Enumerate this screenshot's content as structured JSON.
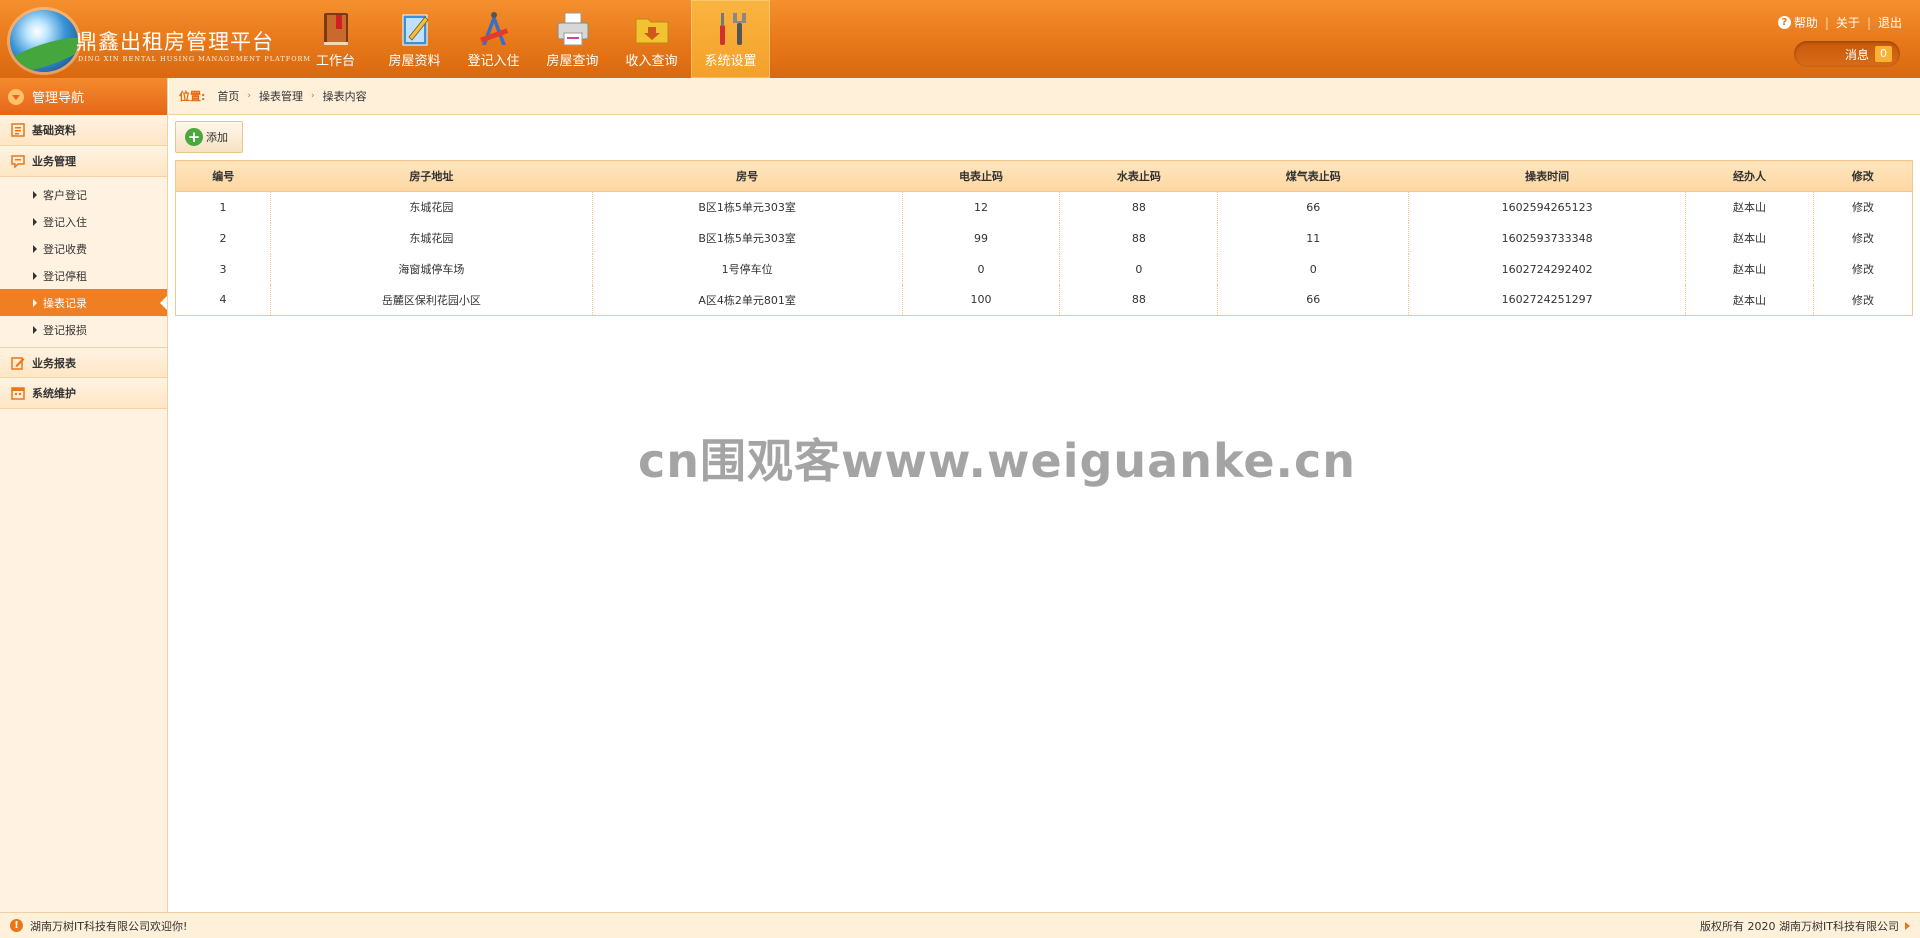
{
  "app": {
    "title": "鼎鑫出租房管理平台",
    "subtitle": "DING XIN RENTAL HUSING MANAGEMENT PLATFORM"
  },
  "topnav": [
    {
      "label": "工作台",
      "icon": "book-icon"
    },
    {
      "label": "房屋资料",
      "icon": "notepad-icon"
    },
    {
      "label": "登记入住",
      "icon": "drafting-tools-icon"
    },
    {
      "label": "房屋查询",
      "icon": "printer-icon"
    },
    {
      "label": "收入查询",
      "icon": "folder-download-icon"
    },
    {
      "label": "系统设置",
      "icon": "tools-icon",
      "active": true
    }
  ],
  "toplinks": {
    "help": "帮助",
    "about": "关于",
    "logout": "退出"
  },
  "messages": {
    "label": "消息",
    "count": "0"
  },
  "sidebar": {
    "title": "管理导航",
    "groups": [
      {
        "label": "基础资料",
        "icon": "list-icon"
      },
      {
        "label": "业务管理",
        "icon": "chat-icon"
      },
      {
        "label": "业务报表",
        "icon": "edit-icon"
      },
      {
        "label": "系统维护",
        "icon": "calendar-icon"
      }
    ],
    "items": [
      "客户登记",
      "登记入住",
      "登记收费",
      "登记停租",
      "操表记录",
      "登记报损"
    ],
    "active_item": "操表记录"
  },
  "breadcrumb": {
    "label": "位置:",
    "items": [
      "首页",
      "操表管理",
      "操表内容"
    ]
  },
  "toolbar": {
    "add_label": "添加"
  },
  "table": {
    "columns": [
      "编号",
      "房子地址",
      "房号",
      "电表止码",
      "水表止码",
      "煤气表止码",
      "操表时间",
      "经办人",
      "修改"
    ],
    "rows": [
      [
        "1",
        "东城花园",
        "B区1栋5单元303室",
        "12",
        "88",
        "66",
        "1602594265123",
        "赵本山",
        "修改"
      ],
      [
        "2",
        "东城花园",
        "B区1栋5单元303室",
        "99",
        "88",
        "11",
        "1602593733348",
        "赵本山",
        "修改"
      ],
      [
        "3",
        "海窗城停车场",
        "1号停车位",
        "0",
        "0",
        "0",
        "1602724292402",
        "赵本山",
        "修改"
      ],
      [
        "4",
        "岳麓区保利花园小区",
        "A区4栋2单元801室",
        "100",
        "88",
        "66",
        "1602724251297",
        "赵本山",
        "修改"
      ]
    ]
  },
  "watermark": "cn围观客www.weiguanke.cn",
  "footer": {
    "left": "湖南万树IT科技有限公司欢迎你!",
    "right": "版权所有 2020 湖南万树IT科技有限公司"
  },
  "colors": {
    "header": "#e7781a",
    "accent": "#f07f24",
    "sidebar_bg": "#fff2e0",
    "table_head": "#fdd7a2"
  }
}
